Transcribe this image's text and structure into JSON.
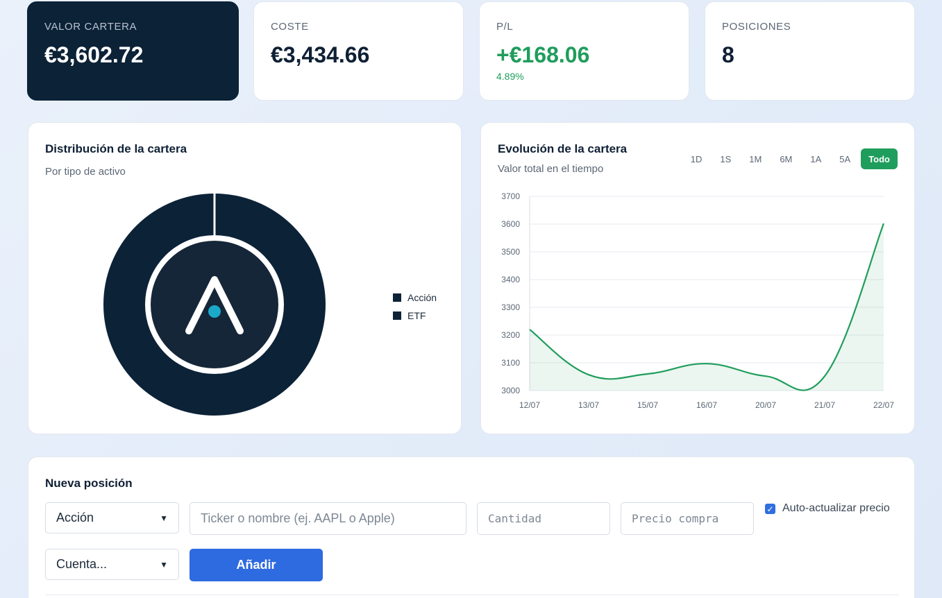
{
  "stats": [
    {
      "label": "VALOR CARTERA",
      "value": "€3,602.72",
      "sub": ""
    },
    {
      "label": "COSTE",
      "value": "€3,434.66",
      "sub": ""
    },
    {
      "label": "P/L",
      "value": "+€168.06",
      "sub": "4.89%"
    },
    {
      "label": "POSICIONES",
      "value": "8",
      "sub": ""
    }
  ],
  "distribution": {
    "title": "Distribución de la cartera",
    "subtitle": "Por tipo de activo",
    "legend": [
      "Acción",
      "ETF"
    ]
  },
  "evolution": {
    "title": "Evolución de la cartera",
    "subtitle": "Valor total en el tiempo",
    "ranges": [
      "1D",
      "1S",
      "1M",
      "6M",
      "1A",
      "5A",
      "Todo"
    ],
    "active_range": "Todo"
  },
  "chart_data": {
    "type": "area",
    "title": "",
    "xlabel": "",
    "ylabel": "",
    "x": [
      "12/07",
      "13/07",
      "15/07",
      "16/07",
      "20/07",
      "21/07",
      "22/07"
    ],
    "values": [
      3220,
      3057,
      3060,
      3097,
      3052,
      3052,
      3602
    ],
    "ylim": [
      3000,
      3700
    ],
    "yticks": [
      3000,
      3100,
      3200,
      3300,
      3400,
      3500,
      3600,
      3700
    ],
    "grid": true,
    "color": "#1f9d5c"
  },
  "form": {
    "title": "Nueva posición",
    "type_value": "Acción",
    "ticker_placeholder": "Ticker o nombre (ej. AAPL o Apple)",
    "quantity_placeholder": "Cantidad",
    "price_placeholder": "Precio compra",
    "auto_update_label": "Auto-actualizar precio",
    "auto_update_checked": true,
    "account_value": "Cuenta...",
    "add_label": "Añadir"
  },
  "colors": {
    "dark": "#0c2237",
    "positive": "#1f9d5c",
    "primary": "#2e6ae0",
    "logo_dot": "#1aa9c9"
  }
}
